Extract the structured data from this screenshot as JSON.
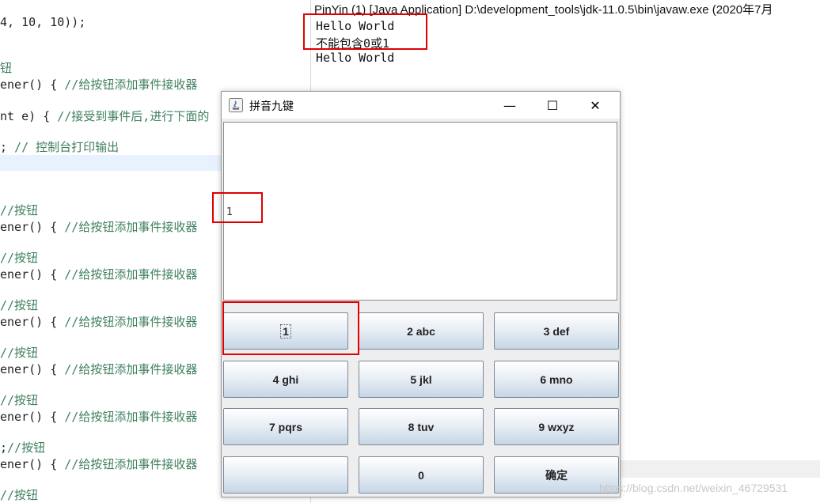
{
  "editor": {
    "lines": [
      {
        "code": "4, 10, 10));",
        "comment": ""
      },
      {
        "code": "",
        "comment": "钮"
      },
      {
        "code": "ener() { ",
        "comment": "//给按钮添加事件接收器"
      },
      {
        "code": "nt e) { ",
        "comment": "//接受到事件后,进行下面的"
      },
      {
        "code": "; ",
        "comment": "// 控制台打印输出"
      },
      {
        "code": "",
        "comment": "//按钮"
      },
      {
        "code": "ener() { ",
        "comment": "//给按钮添加事件接收器"
      },
      {
        "code": "",
        "comment": "//按钮"
      },
      {
        "code": "ener() { ",
        "comment": "//给按钮添加事件接收器"
      },
      {
        "code": "",
        "comment": "//按钮"
      },
      {
        "code": "ener() { ",
        "comment": "//给按钮添加事件接收器"
      },
      {
        "code": "",
        "comment": "//按钮"
      },
      {
        "code": "ener() { ",
        "comment": "//给按钮添加事件接收器"
      },
      {
        "code": "",
        "comment": "//按钮"
      },
      {
        "code": "ener() { ",
        "comment": "//给按钮添加事件接收器"
      },
      {
        "code": ";",
        "comment": "//按钮"
      },
      {
        "code": "ener() { ",
        "comment": "//给按钮添加事件接收器"
      },
      {
        "code": "",
        "comment": "//按钮"
      }
    ]
  },
  "console": {
    "title": "PinYin (1) [Java Application] D:\\development_tools\\jdk-11.0.5\\bin\\javaw.exe  (2020年7月",
    "lines": [
      "Hello World",
      "不能包含0或1",
      "Hello World"
    ]
  },
  "window": {
    "title": "拼音九键",
    "controls": {
      "minimize": "—",
      "maximize": "☐",
      "close": "✕"
    },
    "textarea_value": "1",
    "keys": [
      "1",
      "2 abc",
      "3 def",
      "4 ghi",
      "5 jkl",
      "6 mno",
      "7 pqrs",
      "8 tuv",
      "9 wxyz",
      "",
      "0",
      "确定"
    ]
  },
  "watermark": "https://blog.csdn.net/weixin_46729531",
  "colors": {
    "annotation": "#e00000",
    "comment": "#3f7f5f"
  }
}
